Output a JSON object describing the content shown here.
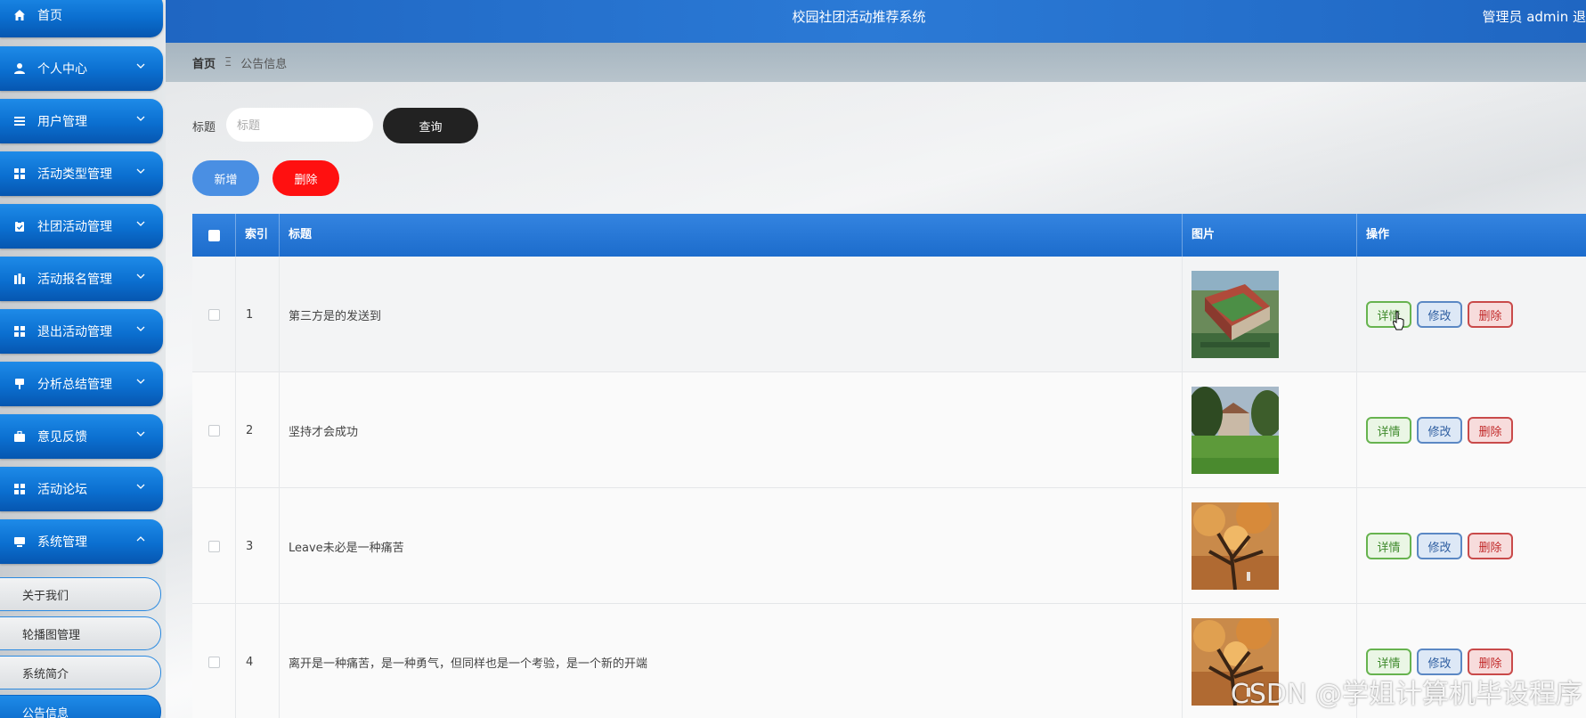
{
  "header": {
    "title": "校园社团活动推荐系统",
    "user": "管理员 admin  退"
  },
  "sidebar": {
    "items": [
      {
        "label": "首页",
        "icon": "home-icon",
        "expandable": false
      },
      {
        "label": "个人中心",
        "icon": "user-icon",
        "expandable": true
      },
      {
        "label": "用户管理",
        "icon": "list-icon",
        "expandable": true
      },
      {
        "label": "活动类型管理",
        "icon": "grid-icon",
        "expandable": true
      },
      {
        "label": "社团活动管理",
        "icon": "clipboard-icon",
        "expandable": true
      },
      {
        "label": "活动报名管理",
        "icon": "chart-icon",
        "expandable": true
      },
      {
        "label": "退出活动管理",
        "icon": "grid-icon",
        "expandable": true
      },
      {
        "label": "分析总结管理",
        "icon": "pin-icon",
        "expandable": true
      },
      {
        "label": "意见反馈",
        "icon": "briefcase-icon",
        "expandable": true
      },
      {
        "label": "活动论坛",
        "icon": "grid-icon",
        "expandable": true
      },
      {
        "label": "系统管理",
        "icon": "monitor-icon",
        "expandable": true,
        "expanded": true
      }
    ],
    "subitems": [
      {
        "label": "关于我们",
        "active": false
      },
      {
        "label": "轮播图管理",
        "active": false
      },
      {
        "label": "系统简介",
        "active": false
      },
      {
        "label": "公告信息",
        "active": true
      }
    ]
  },
  "breadcrumb": {
    "home": "首页",
    "separator": "Ξ",
    "current": "公告信息"
  },
  "search": {
    "label": "标题",
    "placeholder": "标题",
    "query_button": "查询"
  },
  "actions": {
    "add_button": "新增",
    "delete_button": "删除"
  },
  "table": {
    "columns": [
      "索引",
      "标题",
      "图片",
      "操作"
    ],
    "rows": [
      {
        "index": "1",
        "title": "第三方是的发送到",
        "image": "campus-building-aerial"
      },
      {
        "index": "2",
        "title": "坚持才会成功",
        "image": "campus-lawn-building"
      },
      {
        "index": "3",
        "title": "Leave未必是一种痛苦",
        "image": "autumn-tree"
      },
      {
        "index": "4",
        "title": "离开是一种痛苦，是一种勇气，但同样也是一个考验，是一个新的开端",
        "image": "autumn-tree"
      }
    ],
    "row_actions": {
      "detail": "详情",
      "edit": "修改",
      "delete": "删除"
    }
  },
  "watermark": "CSDN @学姐计算机毕设程序",
  "colors": {
    "header_blue": "#1f66c2",
    "nav_blue": "#0b6fd0",
    "table_header_blue": "#1c6ccc",
    "delete_red": "#ff1010",
    "query_black": "#222222",
    "add_blue": "#4a8fe3"
  }
}
